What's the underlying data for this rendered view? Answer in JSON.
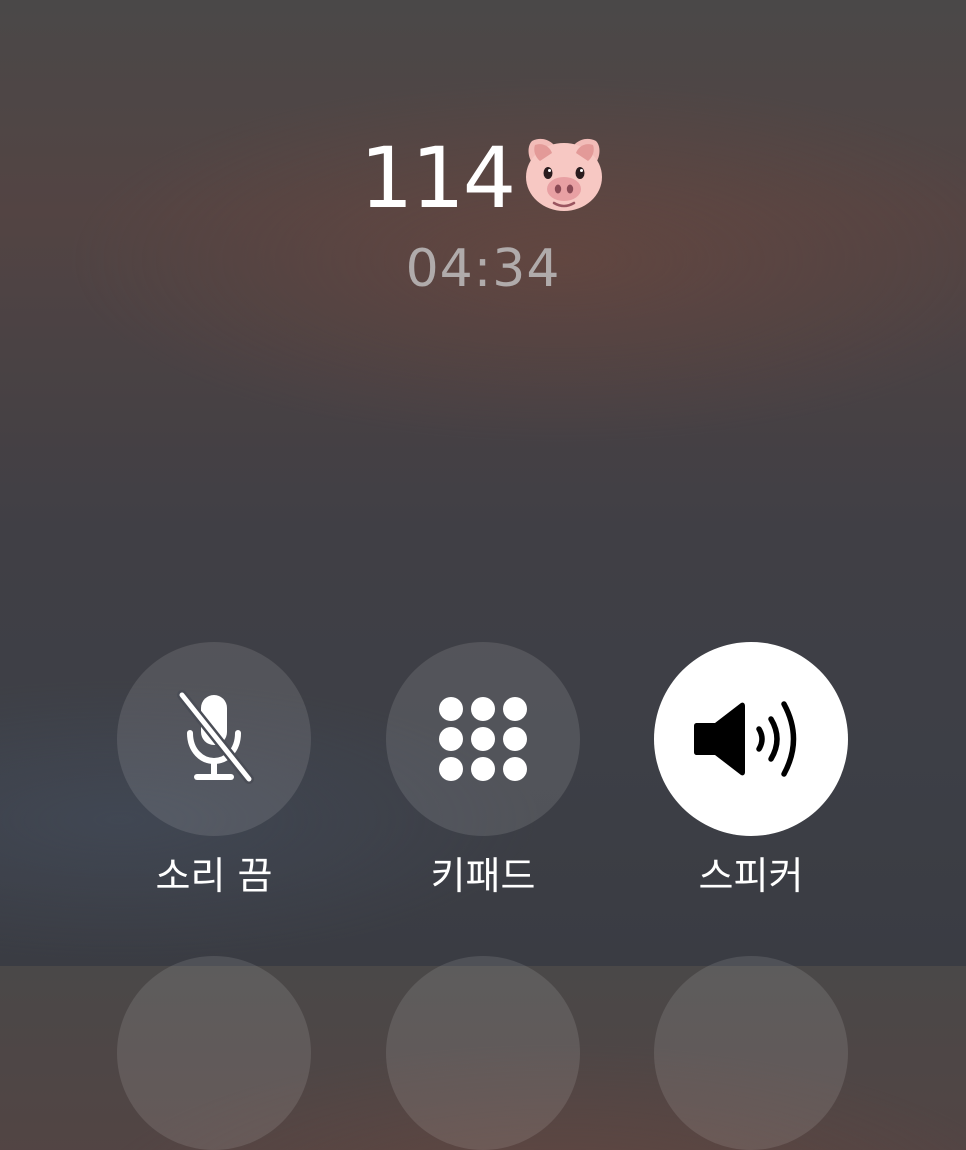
{
  "call": {
    "caller": "114",
    "caller_emoji": "pig-face-icon",
    "duration": "04:34"
  },
  "controls": [
    {
      "label": "소리 끔",
      "icon": "mic-muted-icon",
      "active": false
    },
    {
      "label": "키패드",
      "icon": "keypad-icon",
      "active": false
    },
    {
      "label": "스피커",
      "icon": "speaker-icon",
      "active": true
    }
  ],
  "colors": {
    "active_button": "#ffffff",
    "button_bg": "rgba(255,255,255,0.11)",
    "timer_text": "#b0abab"
  }
}
